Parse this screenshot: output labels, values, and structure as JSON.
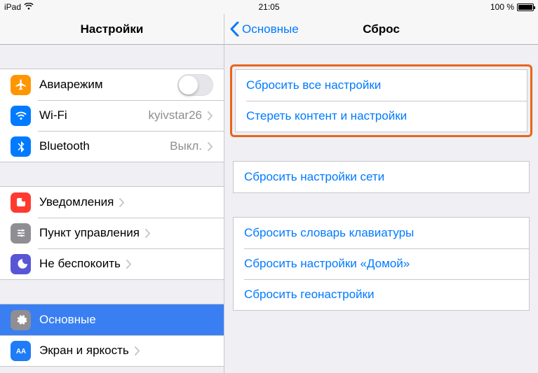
{
  "status": {
    "device": "iPad",
    "time": "21:05",
    "battery_text": "100 %"
  },
  "sidebar": {
    "title": "Настройки",
    "items": {
      "airplane": {
        "label": "Авиарежим"
      },
      "wifi": {
        "label": "Wi-Fi",
        "value": "kyivstar26"
      },
      "bluetooth": {
        "label": "Bluetooth",
        "value": "Выкл."
      },
      "notifications": {
        "label": "Уведомления"
      },
      "control_center": {
        "label": "Пункт управления"
      },
      "dnd": {
        "label": "Не беспокоить"
      },
      "general": {
        "label": "Основные"
      },
      "display": {
        "label": "Экран и яркость"
      }
    }
  },
  "detail": {
    "back_label": "Основные",
    "title": "Сброс",
    "group1": {
      "reset_all": "Сбросить все настройки",
      "erase_all": "Стереть контент и настройки"
    },
    "group2": {
      "reset_network": "Сбросить настройки сети"
    },
    "group3": {
      "reset_keyboard": "Сбросить словарь клавиатуры",
      "reset_home": "Сбросить настройки «Домой»",
      "reset_location": "Сбросить геонастройки"
    }
  }
}
